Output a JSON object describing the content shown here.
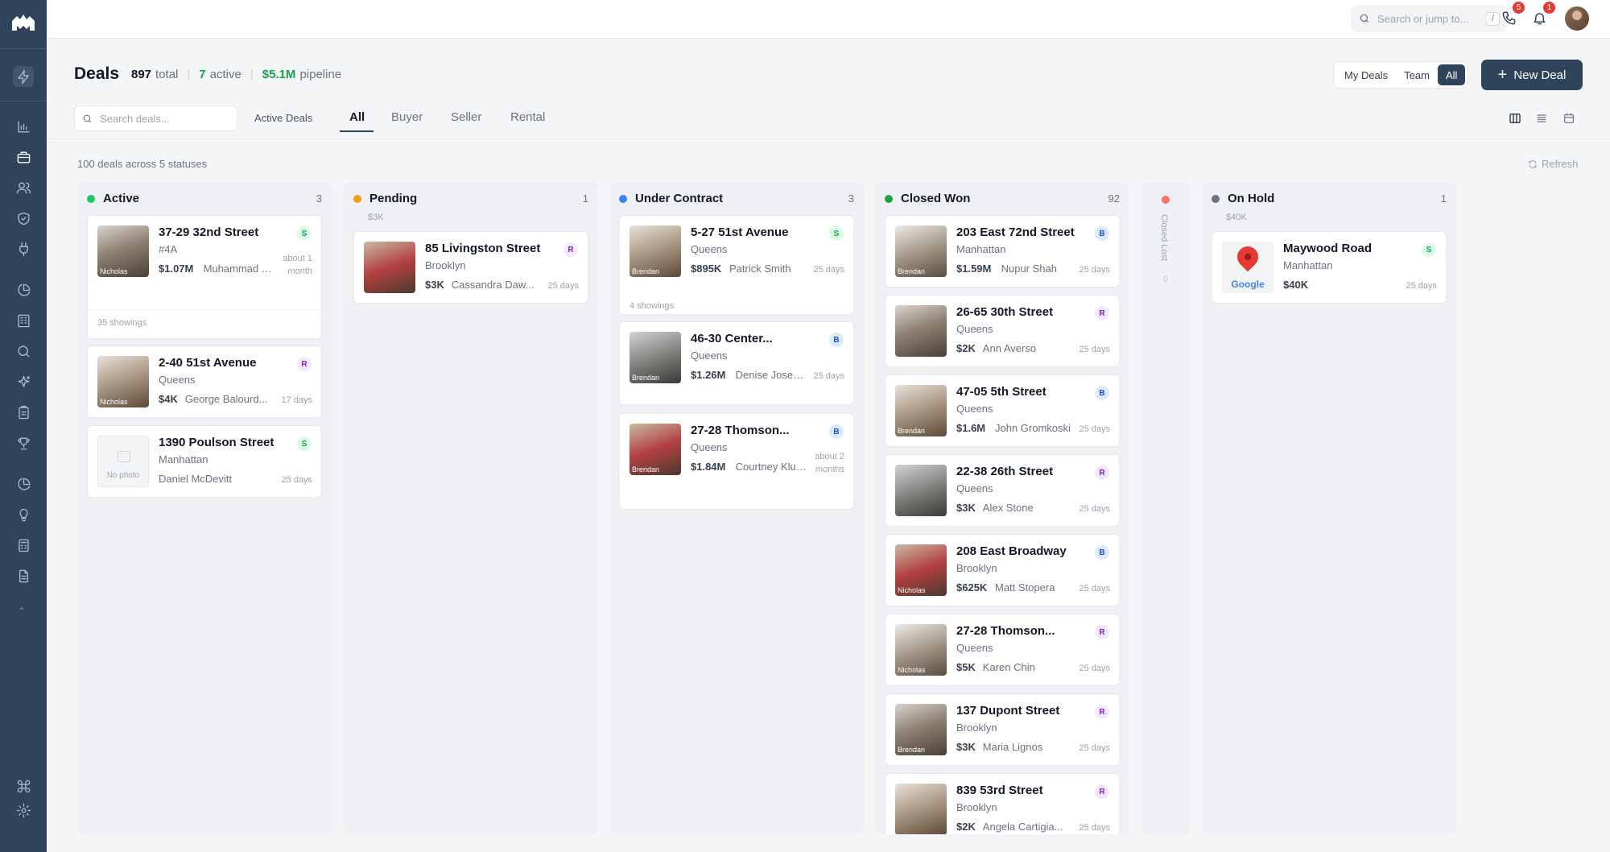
{
  "topbar": {
    "search_placeholder": "Search or jump to...",
    "search_shortcut": "/",
    "calls_badge": "5",
    "notifications_badge": "1"
  },
  "header": {
    "title": "Deals",
    "total_count": "897",
    "total_label": "total",
    "active_count": "7",
    "active_label": "active",
    "pipeline_value": "$5.1M",
    "pipeline_label": "pipeline",
    "scope_options": [
      "My Deals",
      "Team",
      "All"
    ],
    "scope_selected": "All",
    "new_deal_label": "New Deal"
  },
  "filters": {
    "search_placeholder": "Search deals...",
    "active_deals_label": "Active Deals",
    "tabs": [
      "All",
      "Buyer",
      "Seller",
      "Rental"
    ],
    "selected_tab": "All"
  },
  "summary": "100 deals across 5 statuses",
  "refresh_label": "Refresh",
  "colors": {
    "active": "#22c55e",
    "pending": "#f59e0b",
    "under_contract": "#3b82f6",
    "closed_won": "#16a34a",
    "closed_lost": "#f87171",
    "on_hold": "#6b7280",
    "brand": "#2f435a"
  },
  "columns": [
    {
      "name": "Active",
      "count": "3",
      "sub": "",
      "cards": [
        {
          "title": "37-29 32nd Street",
          "location": "#4A",
          "price": "$1.07M",
          "agent": "Muhammad Ch...",
          "age": "about 1 month",
          "type": "S",
          "photo_agent": "Nicholas",
          "footer": "35 showings"
        },
        {
          "title": "2-40 51st Avenue",
          "location": "Queens",
          "price": "$4K",
          "agent": "George Balourd...",
          "age": "17 days",
          "type": "R",
          "photo_agent": "Nicholas"
        },
        {
          "title": "1390 Poulson Street",
          "location": "Manhattan",
          "price": "",
          "agent": "Daniel McDevitt",
          "age": "25 days",
          "type": "S",
          "no_photo": "No photo"
        }
      ]
    },
    {
      "name": "Pending",
      "count": "1",
      "sub": "$3K",
      "cards": [
        {
          "title": "85 Livingston Street",
          "location": "Brooklyn",
          "price": "$3K",
          "agent": "Cassandra Daw...",
          "age": "25 days",
          "type": "R",
          "photo_agent": ""
        }
      ]
    },
    {
      "name": "Under Contract",
      "count": "3",
      "sub": "",
      "cards": [
        {
          "title": "5-27 51st Avenue",
          "location": "Queens",
          "price": "$895K",
          "agent": "Patrick Smith",
          "age": "25 days",
          "type": "S",
          "photo_agent": "Brendan",
          "footer": "4 showings"
        },
        {
          "title": "46-30 Center...",
          "location": "Queens",
          "price": "$1.26M",
          "agent": "Denise Josephs",
          "age": "25 days",
          "type": "B",
          "photo_agent": "Brendan"
        },
        {
          "title": "27-28 Thomson...",
          "location": "Queens",
          "price": "$1.84M",
          "agent": "Courtney Kluger",
          "age": "about 2 months",
          "type": "B",
          "photo_agent": "Brendan"
        }
      ]
    },
    {
      "name": "Closed Won",
      "count": "92",
      "sub": "",
      "cards": [
        {
          "title": "203 East 72nd Street",
          "location": "Manhattan",
          "price": "$1.59M",
          "agent": "Nupur Shah",
          "age": "25 days",
          "type": "B",
          "photo_agent": "Brendan"
        },
        {
          "title": "26-65 30th Street",
          "location": "Queens",
          "price": "$2K",
          "agent": "Ann Averso",
          "age": "25 days",
          "type": "R",
          "photo_agent": ""
        },
        {
          "title": "47-05 5th Street",
          "location": "Queens",
          "price": "$1.6M",
          "agent": "John Gromkoski",
          "age": "25 days",
          "type": "B",
          "photo_agent": "Brendan"
        },
        {
          "title": "22-38 26th Street",
          "location": "Queens",
          "price": "$3K",
          "agent": "Alex Stone",
          "age": "25 days",
          "type": "R",
          "photo_agent": ""
        },
        {
          "title": "208 East Broadway",
          "location": "Brooklyn",
          "price": "$625K",
          "agent": "Matt Stopera",
          "age": "25 days",
          "type": "B",
          "photo_agent": "Nicholas"
        },
        {
          "title": "27-28 Thomson...",
          "location": "Queens",
          "price": "$5K",
          "agent": "Karen Chin",
          "age": "25 days",
          "type": "R",
          "photo_agent": "Nicholas"
        },
        {
          "title": "137 Dupont Street",
          "location": "Brooklyn",
          "price": "$3K",
          "agent": "Maria Lignos",
          "age": "25 days",
          "type": "R",
          "photo_agent": "Brendan"
        },
        {
          "title": "839 53rd Street",
          "location": "Brooklyn",
          "price": "$2K",
          "agent": "Angela Cartigia...",
          "age": "25 days",
          "type": "R",
          "photo_agent": ""
        }
      ]
    },
    {
      "name": "Closed Lost",
      "count": "0",
      "collapsed": true
    },
    {
      "name": "On Hold",
      "count": "1",
      "sub": "$40K",
      "cards": [
        {
          "title": "Maywood Road",
          "location": "Manhattan",
          "price": "$40K",
          "agent": "",
          "age": "25 days",
          "type": "S",
          "map_label": "Google"
        }
      ]
    }
  ]
}
